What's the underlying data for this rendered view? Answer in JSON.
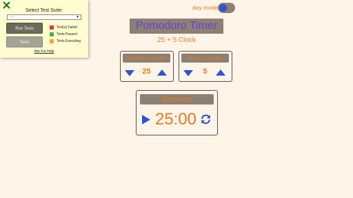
{
  "test_panel": {
    "title": "Select Test Suite:",
    "suite_value": "- - -",
    "run_tests_label": "Run Tests",
    "tests_label": "Tests",
    "legend": [
      {
        "label": "Test(s) Failed",
        "color": "#e53935"
      },
      {
        "label": "Tests Passed",
        "color": "#4caf50"
      },
      {
        "label": "Tests Executing",
        "color": "#f5a623"
      }
    ],
    "help_link": "Ask For Help"
  },
  "mode_toggle": {
    "label": "day mode",
    "knob_color": "#2e54d4",
    "track_color": "#8d7f73"
  },
  "header": {
    "title": "Pomodoro Timer",
    "subtitle": "25 + 5 Clock"
  },
  "session_length": {
    "label": "Session Length",
    "value": "25"
  },
  "break_length": {
    "label": "Break Length",
    "value": "5"
  },
  "timer": {
    "label": "Session",
    "time": "25:00"
  },
  "colors": {
    "background": "#fff4e8",
    "accent_orange": "#e07c20",
    "accent_blue": "#2e54d4",
    "title_purple": "#6c3fe0",
    "panel_brown": "#8d7f73"
  },
  "icons": [
    "close-icon",
    "chevron-down-icon",
    "arrow-down-icon",
    "arrow-up-icon",
    "play-icon",
    "refresh-icon"
  ]
}
